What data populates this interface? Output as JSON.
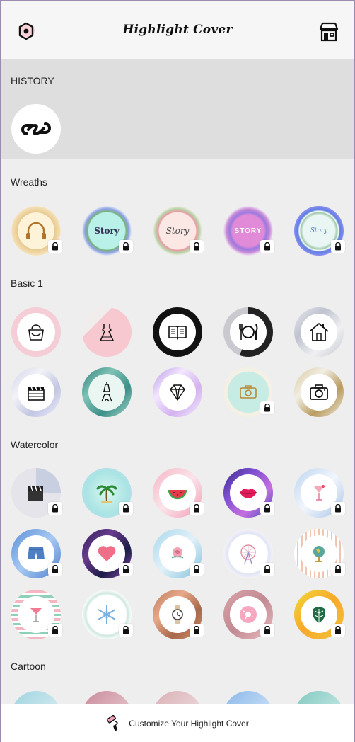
{
  "header": {
    "title": "Highlight Cover",
    "left_icon": "settings-hex-icon",
    "right_icon": "store-icon"
  },
  "sections": {
    "history": "HISTORY",
    "wreaths": "Wreaths",
    "basic1": "Basic 1",
    "watercolor": "Watercolor",
    "cartoon": "Cartoon"
  },
  "wreaths": [
    {
      "icon": "headphones-icon",
      "locked": true,
      "text": ""
    },
    {
      "icon": "story-text-icon",
      "locked": true,
      "text": "Story"
    },
    {
      "icon": "story-text-icon",
      "locked": true,
      "text": "Story"
    },
    {
      "icon": "story-text-icon",
      "locked": true,
      "text": "STORY"
    },
    {
      "icon": "story-text-icon",
      "locked": true,
      "text": "Story"
    }
  ],
  "basic1_row1": [
    {
      "icon": "handbag-icon",
      "locked": false
    },
    {
      "icon": "dress-icon",
      "locked": false
    },
    {
      "icon": "book-icon",
      "locked": false
    },
    {
      "icon": "plate-cutlery-icon",
      "locked": false
    },
    {
      "icon": "house-icon",
      "locked": false
    }
  ],
  "basic1_row2": [
    {
      "icon": "clapperboard-icon",
      "locked": false
    },
    {
      "icon": "eiffel-tower-icon",
      "locked": false
    },
    {
      "icon": "diamond-icon",
      "locked": false
    },
    {
      "icon": "camera-icon",
      "locked": true
    },
    {
      "icon": "camera-icon",
      "locked": false
    }
  ],
  "watercolor_row1": [
    {
      "icon": "clapperboard-icon",
      "locked": true
    },
    {
      "icon": "palm-tree-icon",
      "locked": true
    },
    {
      "icon": "watermelon-icon",
      "locked": true
    },
    {
      "icon": "lips-icon",
      "locked": true
    },
    {
      "icon": "cocktail-icon",
      "locked": true
    }
  ],
  "watercolor_row2": [
    {
      "icon": "shorts-icon",
      "locked": true
    },
    {
      "icon": "heart-icon",
      "locked": true
    },
    {
      "icon": "rose-icon",
      "locked": true
    },
    {
      "icon": "ferris-wheel-icon",
      "locked": true
    },
    {
      "icon": "globe-icon",
      "locked": true
    }
  ],
  "watercolor_row3": [
    {
      "icon": "cocktail-icon",
      "locked": true
    },
    {
      "icon": "snowflake-icon",
      "locked": true
    },
    {
      "icon": "watch-icon",
      "locked": true
    },
    {
      "icon": "donut-icon",
      "locked": true
    },
    {
      "icon": "leaf-icon",
      "locked": true
    }
  ],
  "bottom": {
    "label": "Customize Your Highlight Cover",
    "icon": "paint-roller-icon"
  }
}
